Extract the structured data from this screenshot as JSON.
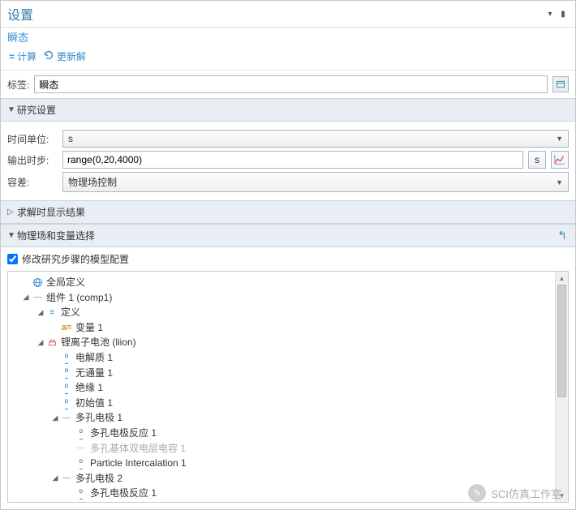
{
  "panel_title": "设置",
  "subtitle": "瞬态",
  "toolbar": {
    "compute_label": "计算",
    "update_label": "更新解"
  },
  "label_row": {
    "label": "标签:",
    "value": "瞬态"
  },
  "sections": {
    "study": {
      "title": "研究设置",
      "time_unit_label": "时间单位:",
      "time_unit_value": "s",
      "output_times_label": "输出时步:",
      "output_times_value": "range(0,20,4000)",
      "output_times_unit": "s",
      "tolerance_label": "容差:",
      "tolerance_value": "物理场控制"
    },
    "results_while": {
      "title": "求解时显示结果"
    },
    "physics_vars": {
      "title": "物理场和变量选择",
      "checkbox_label": "修改研究步骤的模型配置"
    }
  },
  "tree": [
    {
      "depth": 0,
      "twisty": "",
      "icon": "globe",
      "label": "全局定义"
    },
    {
      "depth": 0,
      "twisty": "▲",
      "icon": "line",
      "label": "组件 1 (comp1)"
    },
    {
      "depth": 1,
      "twisty": "▲",
      "icon": "menu",
      "label": "定义"
    },
    {
      "depth": 2,
      "twisty": "",
      "icon": "a",
      "label": "变量 1"
    },
    {
      "depth": 1,
      "twisty": "▲",
      "icon": "phys",
      "label": "锂离子电池 (liion)"
    },
    {
      "depth": 2,
      "twisty": "",
      "icon": "d",
      "label": "电解质 1"
    },
    {
      "depth": 2,
      "twisty": "",
      "icon": "d",
      "label": "无通量 1"
    },
    {
      "depth": 2,
      "twisty": "",
      "icon": "d",
      "label": "绝缘 1"
    },
    {
      "depth": 2,
      "twisty": "",
      "icon": "d",
      "label": "初始值 1"
    },
    {
      "depth": 2,
      "twisty": "▲",
      "icon": "line",
      "label": "多孔电极 1"
    },
    {
      "depth": 3,
      "twisty": "",
      "icon": "d",
      "label": "多孔电极反应 1"
    },
    {
      "depth": 3,
      "twisty": "",
      "icon": "line-dim",
      "label": "多孔基体双电层电容 1"
    },
    {
      "depth": 3,
      "twisty": "",
      "icon": "d",
      "label": "Particle Intercalation 1"
    },
    {
      "depth": 2,
      "twisty": "▲",
      "icon": "line",
      "label": "多孔电极 2"
    },
    {
      "depth": 3,
      "twisty": "",
      "icon": "d",
      "label": "多孔电极反应 1"
    }
  ],
  "watermark": "SCI仿真工作室"
}
